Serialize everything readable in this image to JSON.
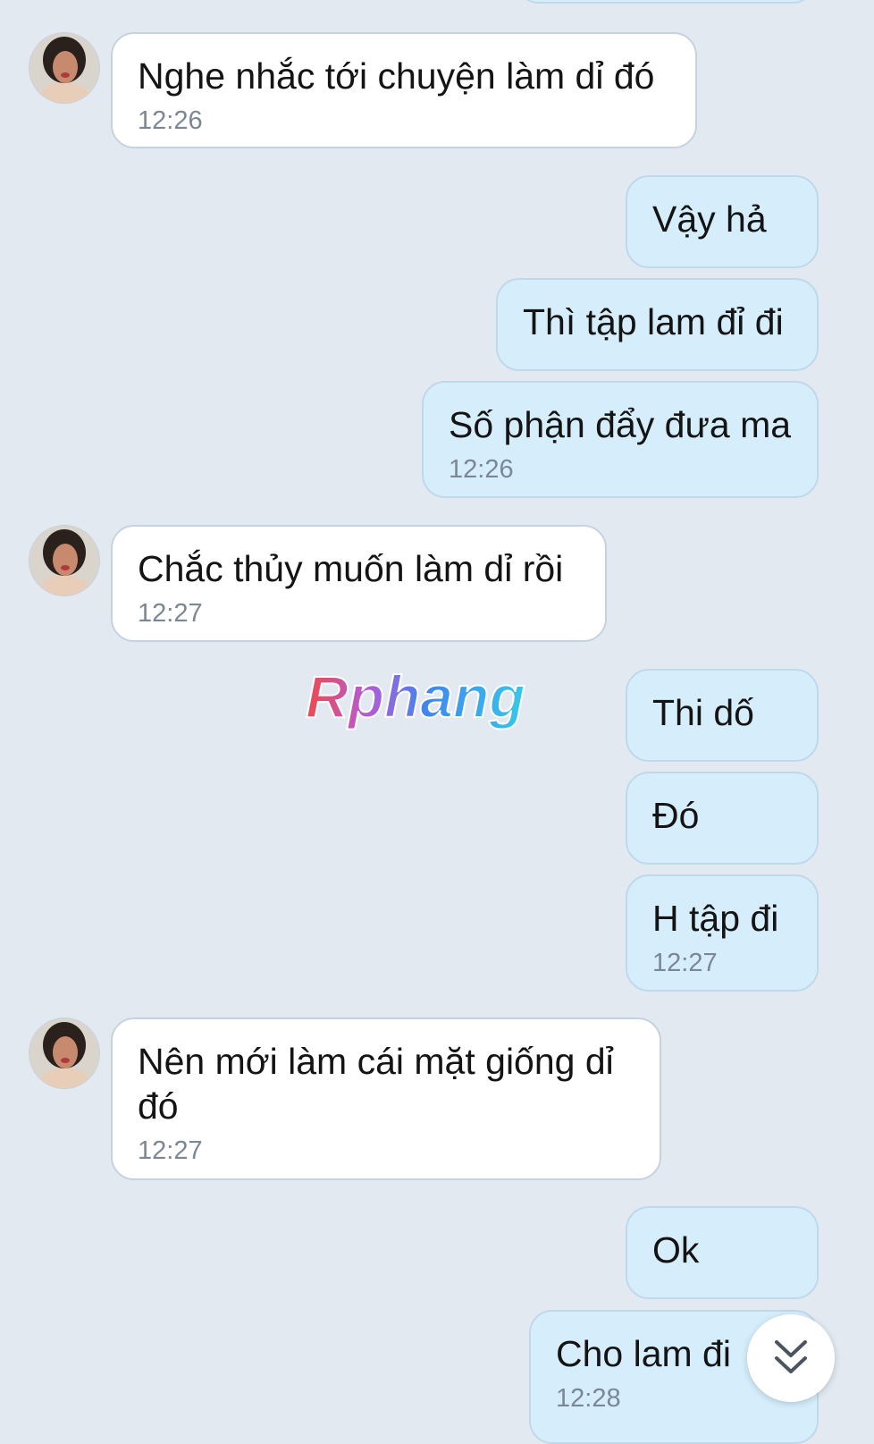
{
  "messages": [
    {
      "text": "Nghe nhắc tới chuyện làm dỉ đó",
      "time": "12:26"
    },
    {
      "text": "Vậy hả"
    },
    {
      "text": "Thì tập lam đỉ đi"
    },
    {
      "text": "Số phận đẩy đưa ma",
      "time": "12:26"
    },
    {
      "text": "Chắc thủy muốn làm dỉ rồi",
      "time": "12:27"
    },
    {
      "text": "Thi dố"
    },
    {
      "text": "Đó"
    },
    {
      "text": "H tập đi",
      "time": "12:27"
    },
    {
      "text": "Nên mới làm cái mặt giống dỉ đó",
      "time": "12:27"
    },
    {
      "text": "Ok"
    },
    {
      "text": "Cho lam đi",
      "time": "12:28"
    }
  ],
  "watermark": {
    "text": "Rphang"
  },
  "colors": {
    "background": "#e2e9f1",
    "incoming_bubble": "#ffffff",
    "outgoing_bubble": "#d6eefc",
    "timestamp": "#7b8793"
  },
  "icons": {
    "scroll_down": "double-chevron-down-icon",
    "avatar": "user-avatar"
  }
}
